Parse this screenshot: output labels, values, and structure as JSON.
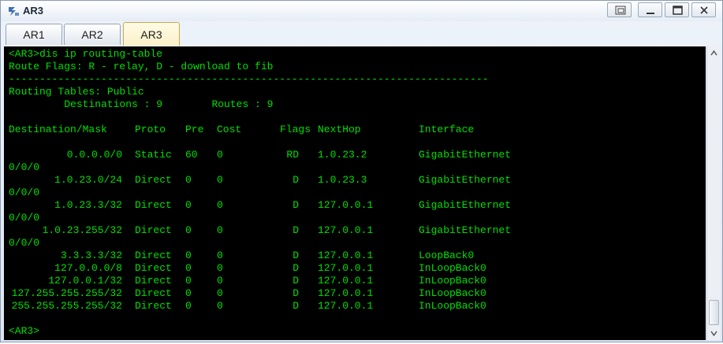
{
  "window": {
    "title": "AR3",
    "controls": [
      "restore-icon",
      "minimize-icon",
      "maximize-icon",
      "close-icon"
    ]
  },
  "tabs": [
    {
      "label": "AR1",
      "active": false
    },
    {
      "label": "AR2",
      "active": false
    },
    {
      "label": "AR3",
      "active": true
    }
  ],
  "terminal": {
    "text_color": "#00e000",
    "background": "#000000",
    "header_lines": [
      "<AR3>dis ip routing-table",
      "Route Flags: R - relay, D - download to fib",
      "------------------------------------------------------------------------------",
      "Routing Tables: Public",
      "         Destinations : 9        Routes : 9"
    ],
    "columns": [
      "Destination/Mask",
      "Proto",
      "Pre",
      "Cost",
      "Flags",
      "NextHop",
      "Interface"
    ],
    "routes": [
      {
        "dest": "0.0.0.0/0",
        "proto": "Static",
        "pre": "60",
        "cost": "0",
        "flags": "RD",
        "nexthop": "1.0.23.2",
        "iface": "GigabitEthernet",
        "wrap": "0/0/0"
      },
      {
        "dest": "1.0.23.0/24",
        "proto": "Direct",
        "pre": "0",
        "cost": "0",
        "flags": "D",
        "nexthop": "1.0.23.3",
        "iface": "GigabitEthernet",
        "wrap": "0/0/0"
      },
      {
        "dest": "1.0.23.3/32",
        "proto": "Direct",
        "pre": "0",
        "cost": "0",
        "flags": "D",
        "nexthop": "127.0.0.1",
        "iface": "GigabitEthernet",
        "wrap": "0/0/0"
      },
      {
        "dest": "1.0.23.255/32",
        "proto": "Direct",
        "pre": "0",
        "cost": "0",
        "flags": "D",
        "nexthop": "127.0.0.1",
        "iface": "GigabitEthernet",
        "wrap": "0/0/0"
      },
      {
        "dest": "3.3.3.3/32",
        "proto": "Direct",
        "pre": "0",
        "cost": "0",
        "flags": "D",
        "nexthop": "127.0.0.1",
        "iface": "LoopBack0",
        "wrap": ""
      },
      {
        "dest": "127.0.0.0/8",
        "proto": "Direct",
        "pre": "0",
        "cost": "0",
        "flags": "D",
        "nexthop": "127.0.0.1",
        "iface": "InLoopBack0",
        "wrap": ""
      },
      {
        "dest": "127.0.0.1/32",
        "proto": "Direct",
        "pre": "0",
        "cost": "0",
        "flags": "D",
        "nexthop": "127.0.0.1",
        "iface": "InLoopBack0",
        "wrap": ""
      },
      {
        "dest": "127.255.255.255/32",
        "proto": "Direct",
        "pre": "0",
        "cost": "0",
        "flags": "D",
        "nexthop": "127.0.0.1",
        "iface": "InLoopBack0",
        "wrap": ""
      },
      {
        "dest": "255.255.255.255/32",
        "proto": "Direct",
        "pre": "0",
        "cost": "0",
        "flags": "D",
        "nexthop": "127.0.0.1",
        "iface": "InLoopBack0",
        "wrap": ""
      }
    ],
    "prompt": "<AR3>"
  },
  "scrollbar": {
    "up_icon": "scroll-up-icon",
    "down_icon": "scroll-down-icon"
  }
}
